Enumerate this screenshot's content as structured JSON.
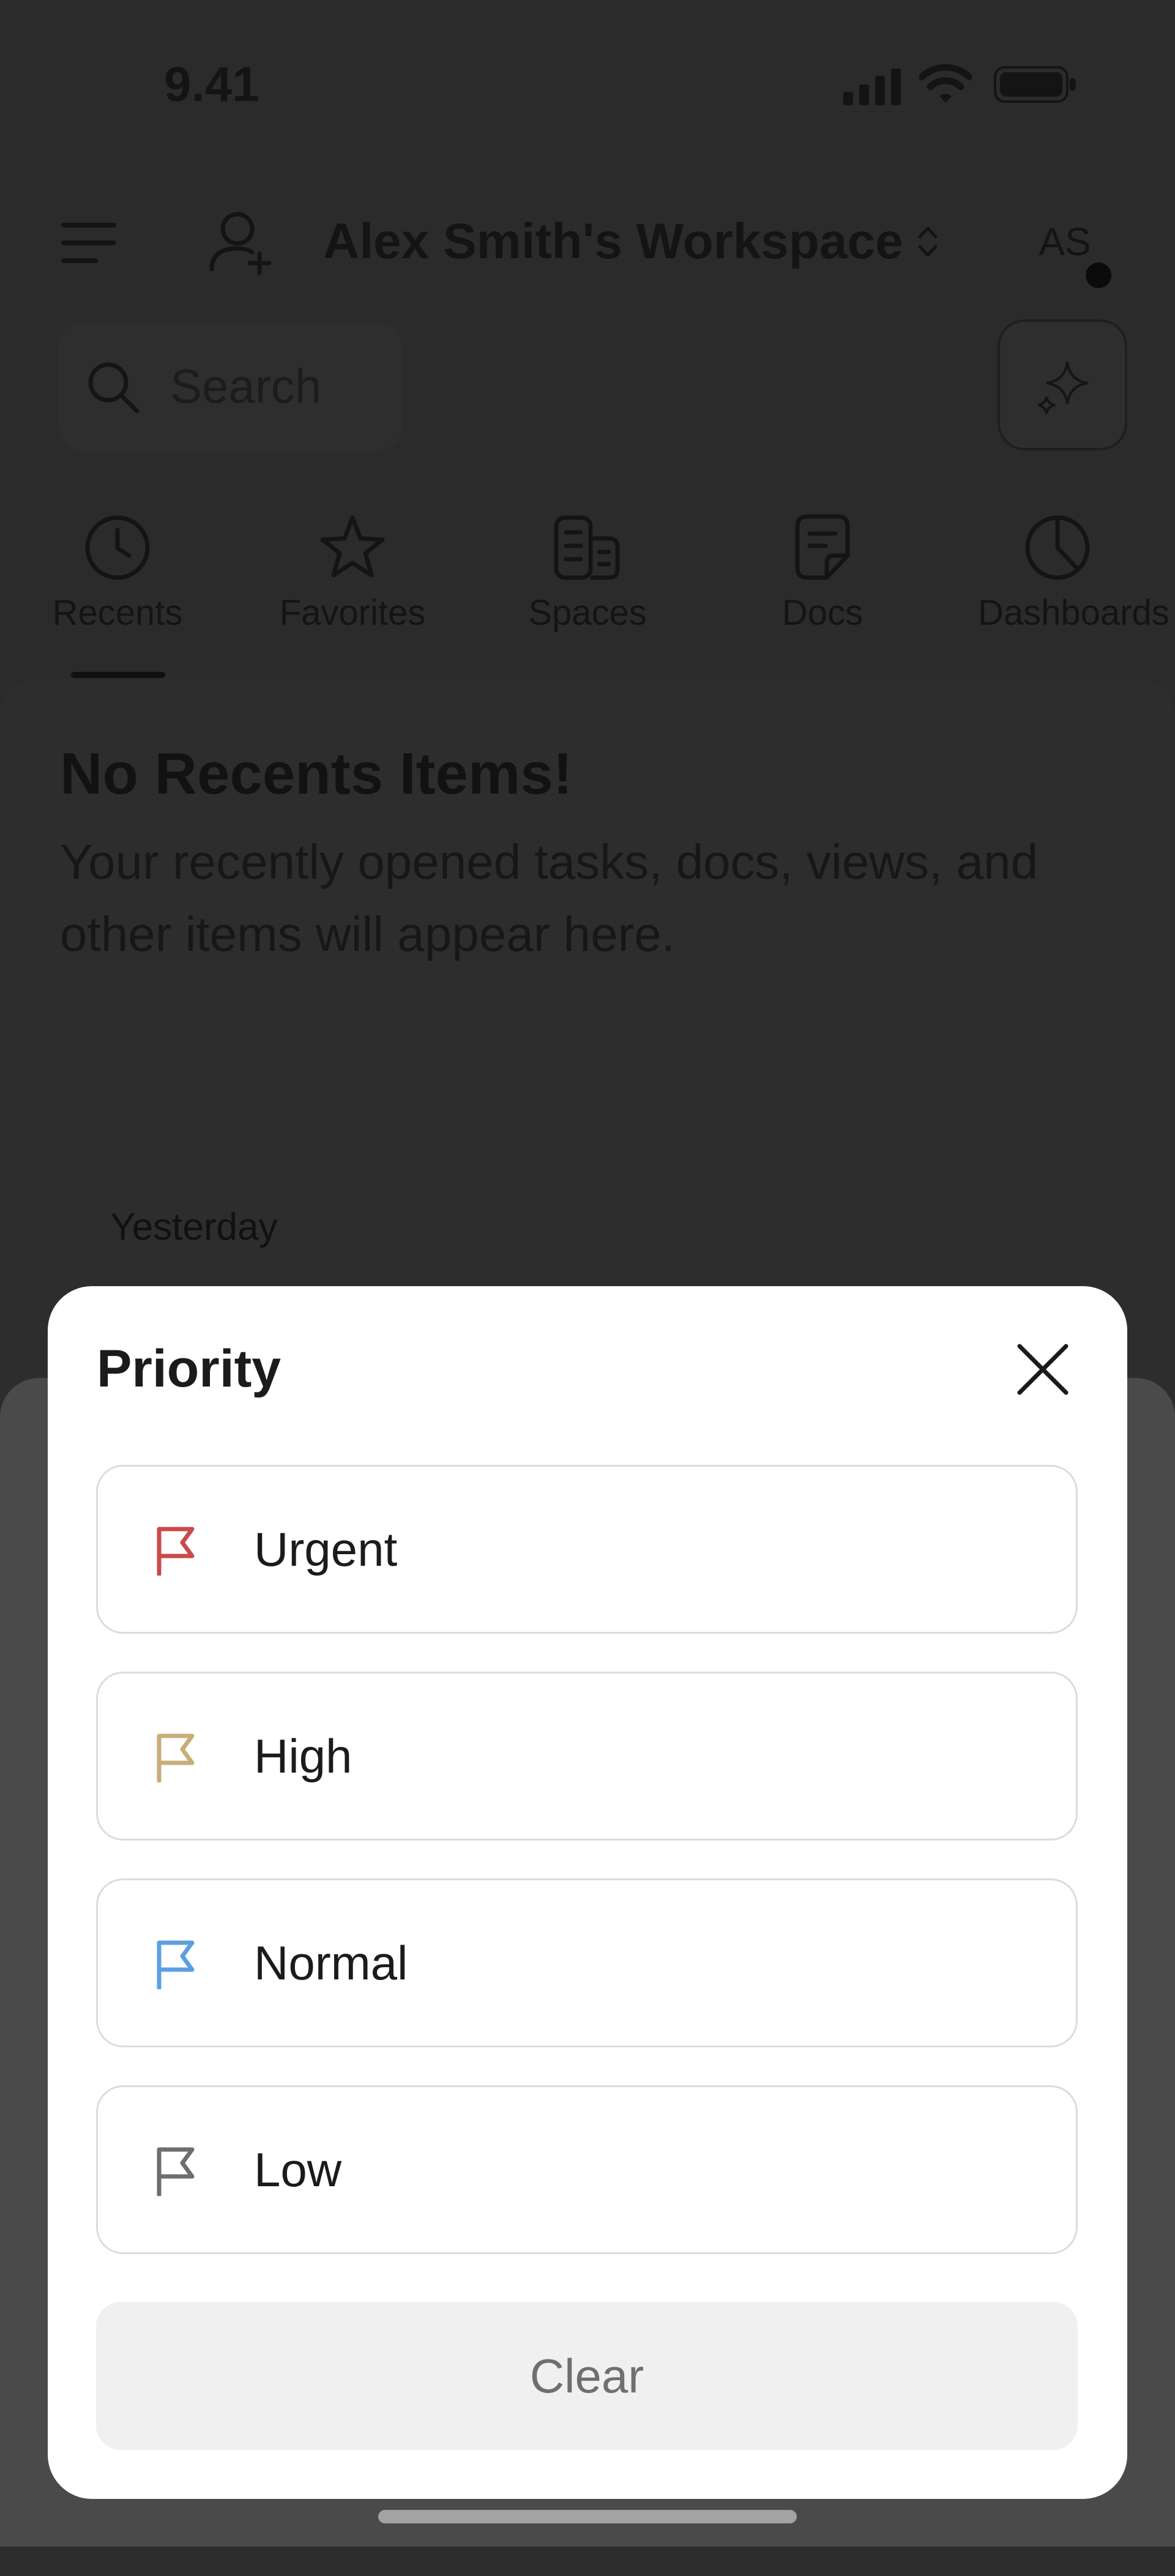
{
  "status_bar": {
    "time": "9.41"
  },
  "header": {
    "workspace_name": "Alex Smith's Workspace",
    "avatar_initials": "AS"
  },
  "search": {
    "placeholder": "Search"
  },
  "nav_tabs": [
    {
      "label": "Recents",
      "icon": "clock-icon"
    },
    {
      "label": "Favorites",
      "icon": "star-icon"
    },
    {
      "label": "Spaces",
      "icon": "spaces-icon"
    },
    {
      "label": "Docs",
      "icon": "doc-icon"
    },
    {
      "label": "Dashboards",
      "icon": "pie-chart-icon"
    }
  ],
  "empty_state": {
    "title": "No Recents Items!",
    "description": "Your recently opened tasks, docs, views, and other items will appear here."
  },
  "section_label": "Yesterday",
  "modal": {
    "title": "Priority",
    "options": [
      {
        "label": "Urgent",
        "color": "#c94a4a"
      },
      {
        "label": "High",
        "color": "#c9ad79"
      },
      {
        "label": "Normal",
        "color": "#5c9fe0"
      },
      {
        "label": "Low",
        "color": "#6e6e6e"
      }
    ],
    "clear_label": "Clear"
  }
}
